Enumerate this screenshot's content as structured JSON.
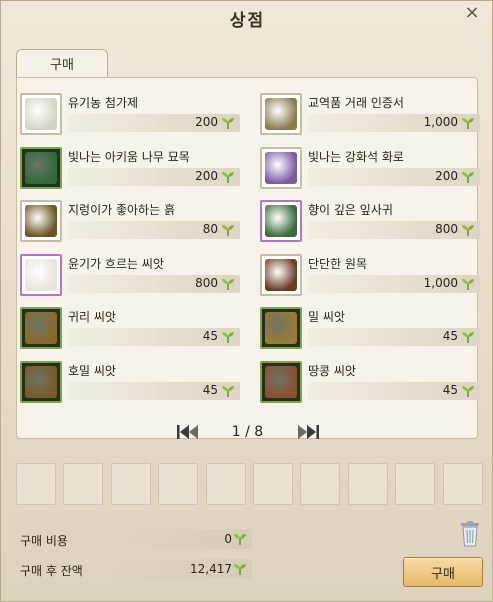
{
  "window": {
    "title": "상점"
  },
  "tabs": [
    {
      "label": "구매"
    }
  ],
  "items": [
    {
      "name": "유기농 첨가제",
      "price": "200",
      "frame": "plain",
      "art": "#d6d2c4"
    },
    {
      "name": "교역품 거래 인증서",
      "price": "1,000",
      "frame": "plain",
      "art": "#8a7a50"
    },
    {
      "name": "빛나는 아키움 나무 묘목",
      "price": "200",
      "frame": "green",
      "art": "#2f6a3a"
    },
    {
      "name": "빛나는 강화석 화로",
      "price": "200",
      "frame": "plain",
      "art": "#7a5aa0"
    },
    {
      "name": "지렁이가 좋아하는 흙",
      "price": "80",
      "frame": "plain",
      "art": "#6b5524"
    },
    {
      "name": "향이 깊은 잎사귀",
      "price": "800",
      "frame": "purple",
      "art": "#3c6a3e"
    },
    {
      "name": "윤기가 흐르는 씨앗",
      "price": "800",
      "frame": "purple",
      "art": "#e9e4dc"
    },
    {
      "name": "단단한 원목",
      "price": "1,000",
      "frame": "plain",
      "art": "#6a3a24"
    },
    {
      "name": "귀리 씨앗",
      "price": "45",
      "frame": "green",
      "art": "#8a6a2a"
    },
    {
      "name": "밀 씨앗",
      "price": "45",
      "frame": "green",
      "art": "#9a7a34"
    },
    {
      "name": "호밀 씨앗",
      "price": "45",
      "frame": "green",
      "art": "#7a5a2a"
    },
    {
      "name": "땅콩 씨앗",
      "price": "45",
      "frame": "green",
      "art": "#8a5030"
    }
  ],
  "pagination": {
    "text": "1 / 8"
  },
  "summary": {
    "cost_label": "구매 비용",
    "cost_value": "0",
    "balance_label": "구매 후 잔액",
    "balance_value": "12,417"
  },
  "buttons": {
    "buy_label": "구매"
  },
  "colors": {
    "accent": "#e8b86a",
    "green_frame": "#7ca24e",
    "purple_frame": "#b474c4"
  },
  "icons": {
    "currency": "sprout-icon",
    "trash": "trash-icon",
    "first_page": "first-page-icon",
    "last_page": "last-page-icon"
  }
}
